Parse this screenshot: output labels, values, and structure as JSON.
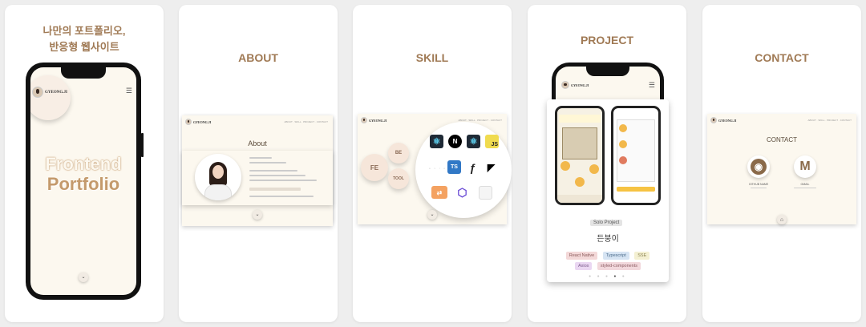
{
  "cards": {
    "intro": {
      "title_line1": "나만의 포트폴리오,",
      "title_line2": "반응형 웹사이트",
      "brand": "GYEONG.JI",
      "hero_line1": "Frontend",
      "hero_line2": "Portfolio"
    },
    "about": {
      "heading": "ABOUT",
      "brand": "GYEONG.JI",
      "section_title": "About",
      "nav": "ABOUT · SKILL · PROJECT · CONTACT"
    },
    "skill": {
      "heading": "SKILL",
      "brand": "GYEONG.JI",
      "bubble_fe": "FE",
      "bubble_be": "BE",
      "bubble_tool": "TOOL",
      "nav": "ABOUT · SKILL · PROJECT · CONTACT",
      "icons": [
        {
          "name": "react-icon",
          "glyph": "⚛",
          "bg": "#1f2a36",
          "fg": "#61dafb"
        },
        {
          "name": "nextjs-icon",
          "glyph": "N",
          "bg": "#000000",
          "fg": "#ffffff"
        },
        {
          "name": "react-native-icon",
          "glyph": "⚛",
          "bg": "#1f2a36",
          "fg": "#61dafb"
        },
        {
          "name": "javascript-icon",
          "glyph": "JS",
          "bg": "#f0db4f",
          "fg": "#222222"
        },
        {
          "name": "typescript-icon",
          "glyph": "TS",
          "bg": "#3178c6",
          "fg": "#ffffff"
        },
        {
          "name": "framer-motion-icon",
          "glyph": "ƒ",
          "bg": "transparent",
          "fg": "#222222"
        },
        {
          "name": "framer-icon",
          "glyph": "◤",
          "bg": "transparent",
          "fg": "#000000"
        }
      ]
    },
    "project": {
      "heading": "PROJECT",
      "brand": "GYEONG.JI",
      "tag": "Solo Project",
      "title": "든붕이",
      "stack": [
        "React Native",
        "Typescript",
        "SSE",
        "Axios",
        "styled-components"
      ]
    },
    "contact": {
      "heading": "CONTACT",
      "brand": "GYEONG.JI",
      "section_title": "CONTACT",
      "github_label": "GITHUB NAME",
      "gmail_label": "GMAIL",
      "nav": "ABOUT · SKILL · PROJECT · CONTACT"
    }
  },
  "colors": {
    "accent": "#a07a55",
    "cream": "#fcf8ef",
    "hero_text": "#c49a6c"
  }
}
